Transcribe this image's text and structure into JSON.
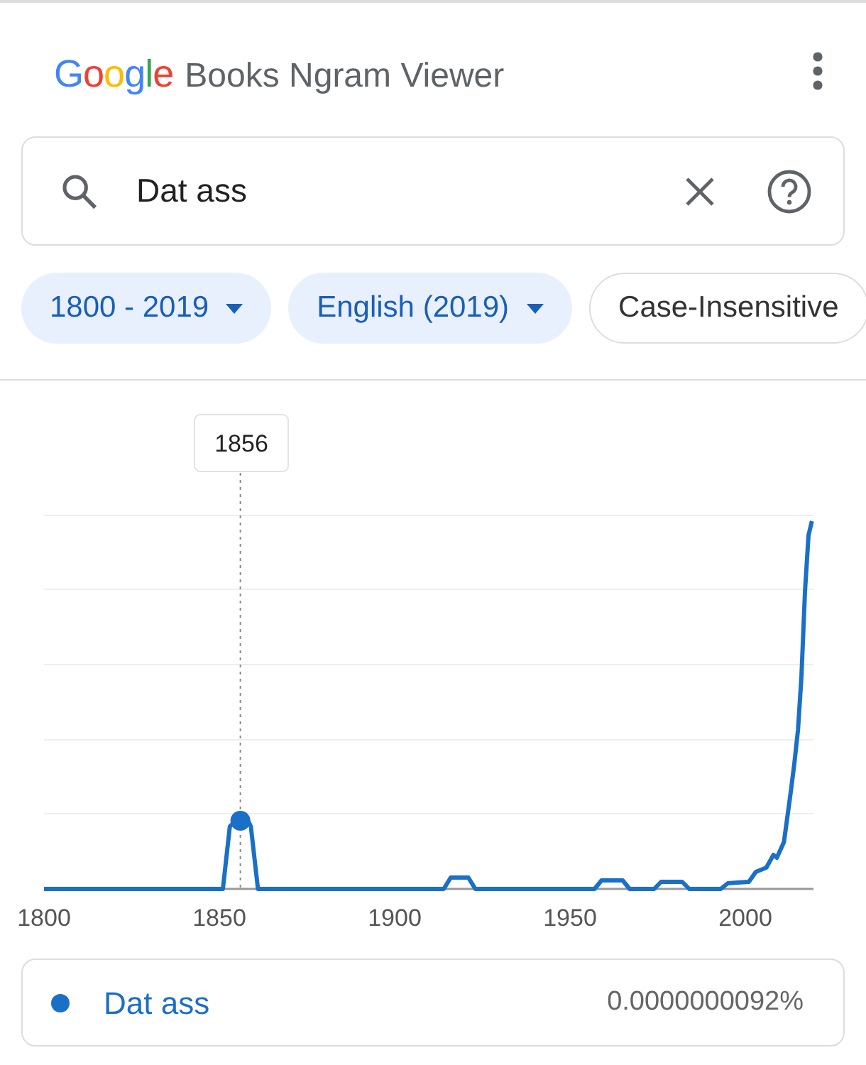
{
  "header": {
    "logo": "Google",
    "title": "Books Ngram Viewer"
  },
  "search": {
    "value": "Dat ass"
  },
  "chips": [
    {
      "label": "1800 - 2019",
      "kind": "dropdown"
    },
    {
      "label": "English (2019)",
      "kind": "dropdown"
    },
    {
      "label": "Case-Insensitive",
      "kind": "toggle"
    }
  ],
  "chart": {
    "tooltip": "1856",
    "x_tick_labels": [
      "1800",
      "1850",
      "1900",
      "1950",
      "2000"
    ]
  },
  "legend": [
    {
      "name": "Dat ass",
      "value": "0.0000000092%"
    }
  ]
}
